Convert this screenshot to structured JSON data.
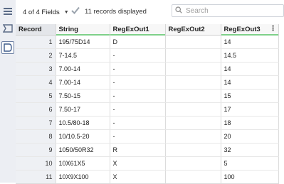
{
  "toolbar": {
    "fields_selector": "4 of 4 Fields",
    "records_text": "11 records displayed",
    "search_placeholder": "Search"
  },
  "table": {
    "headers": [
      "Record",
      "String",
      "RegExOut1",
      "RegExOut2",
      "RegExOut3"
    ],
    "rows": [
      [
        "1",
        "195/75D14",
        "D",
        "",
        "14"
      ],
      [
        "2",
        "7-14.5",
        "-",
        "",
        "14.5"
      ],
      [
        "3",
        "7.00-14",
        "-",
        "",
        "14"
      ],
      [
        "4",
        "7.00-14",
        "-",
        "",
        "14"
      ],
      [
        "5",
        "7.50-15",
        "-",
        "",
        "15"
      ],
      [
        "6",
        "7.50-17",
        "-",
        "",
        "17"
      ],
      [
        "7",
        "10.5/80-18",
        "-",
        "",
        "18"
      ],
      [
        "8",
        "10/10.5-20",
        "-",
        "",
        "20"
      ],
      [
        "9",
        "1050/50R32",
        "R",
        "",
        "32"
      ],
      [
        "10",
        "10X61X5",
        "X",
        "",
        "5"
      ],
      [
        "11",
        "10X9X100",
        "X",
        "",
        "100"
      ]
    ]
  },
  "colors": {
    "header_underline": "#7fd089",
    "rail_bg": "#eceef3"
  },
  "icons": [
    "table-view-icon",
    "field-list-icon",
    "cell-view-icon",
    "chevron-down-icon",
    "checkmark-icon",
    "search-icon",
    "kebab-menu-icon"
  ]
}
